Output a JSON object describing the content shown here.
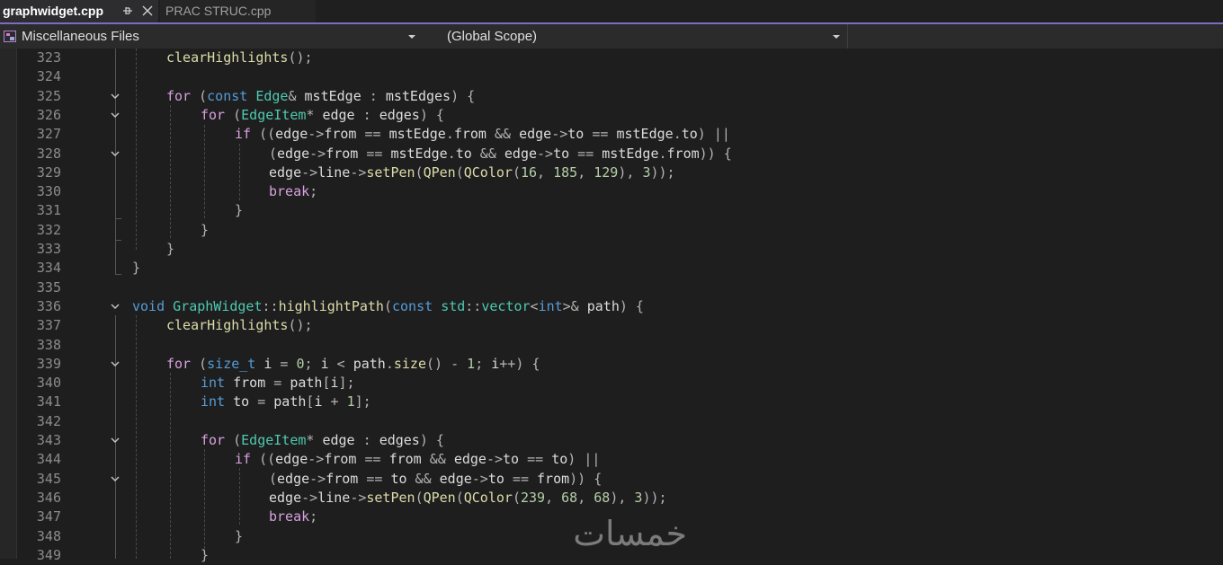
{
  "tabs": [
    {
      "title": "graphwidget.cpp",
      "active": true,
      "pin_icon": "pin-icon",
      "close_icon": "close-icon"
    },
    {
      "title": "PRAC STRUC.cpp",
      "active": false
    }
  ],
  "navbar": {
    "project": "Miscellaneous Files",
    "project_icon": "cpp-file-icon",
    "scope": "(Global Scope)"
  },
  "colors": {
    "accent": "#7e6bc4",
    "keyword_blue": "#569cd6",
    "keyword_control": "#d8a0df",
    "function": "#dcdcaa",
    "type": "#4ec9b0",
    "number": "#b5cea8"
  },
  "code_lines": [
    {
      "num": "323",
      "fold": "",
      "text": "    clearHighlights();"
    },
    {
      "num": "324",
      "fold": "",
      "text": ""
    },
    {
      "num": "325",
      "fold": "chevron-down-icon",
      "text": "    for (const Edge& mstEdge : mstEdges) {"
    },
    {
      "num": "326",
      "fold": "chevron-down-icon",
      "text": "        for (EdgeItem* edge : edges) {"
    },
    {
      "num": "327",
      "fold": "",
      "text": "            if ((edge->from == mstEdge.from && edge->to == mstEdge.to) ||"
    },
    {
      "num": "328",
      "fold": "chevron-down-icon",
      "text": "                (edge->from == mstEdge.to && edge->to == mstEdge.from)) {"
    },
    {
      "num": "329",
      "fold": "",
      "text": "                edge->line->setPen(QPen(QColor(16, 185, 129), 3));"
    },
    {
      "num": "330",
      "fold": "",
      "text": "                break;"
    },
    {
      "num": "331",
      "fold": "",
      "text": "            }"
    },
    {
      "num": "332",
      "fold": "",
      "text": "        }"
    },
    {
      "num": "333",
      "fold": "",
      "text": "    }"
    },
    {
      "num": "334",
      "fold": "",
      "text": "}"
    },
    {
      "num": "335",
      "fold": "",
      "text": ""
    },
    {
      "num": "336",
      "fold": "chevron-down-icon",
      "text": "void GraphWidget::highlightPath(const std::vector<int>& path) {"
    },
    {
      "num": "337",
      "fold": "",
      "text": "    clearHighlights();"
    },
    {
      "num": "338",
      "fold": "",
      "text": ""
    },
    {
      "num": "339",
      "fold": "chevron-down-icon",
      "text": "    for (size_t i = 0; i < path.size() - 1; i++) {"
    },
    {
      "num": "340",
      "fold": "",
      "text": "        int from = path[i];"
    },
    {
      "num": "341",
      "fold": "",
      "text": "        int to = path[i + 1];"
    },
    {
      "num": "342",
      "fold": "",
      "text": ""
    },
    {
      "num": "343",
      "fold": "chevron-down-icon",
      "text": "        for (EdgeItem* edge : edges) {"
    },
    {
      "num": "344",
      "fold": "",
      "text": "            if ((edge->from == from && edge->to == to) ||"
    },
    {
      "num": "345",
      "fold": "chevron-down-icon",
      "text": "                (edge->from == to && edge->to == from)) {"
    },
    {
      "num": "346",
      "fold": "",
      "text": "                edge->line->setPen(QPen(QColor(239, 68, 68), 3));"
    },
    {
      "num": "347",
      "fold": "",
      "text": "                break;"
    },
    {
      "num": "348",
      "fold": "",
      "text": "            }"
    },
    {
      "num": "349",
      "fold": "",
      "text": "        }"
    }
  ],
  "watermark": "خمسات"
}
